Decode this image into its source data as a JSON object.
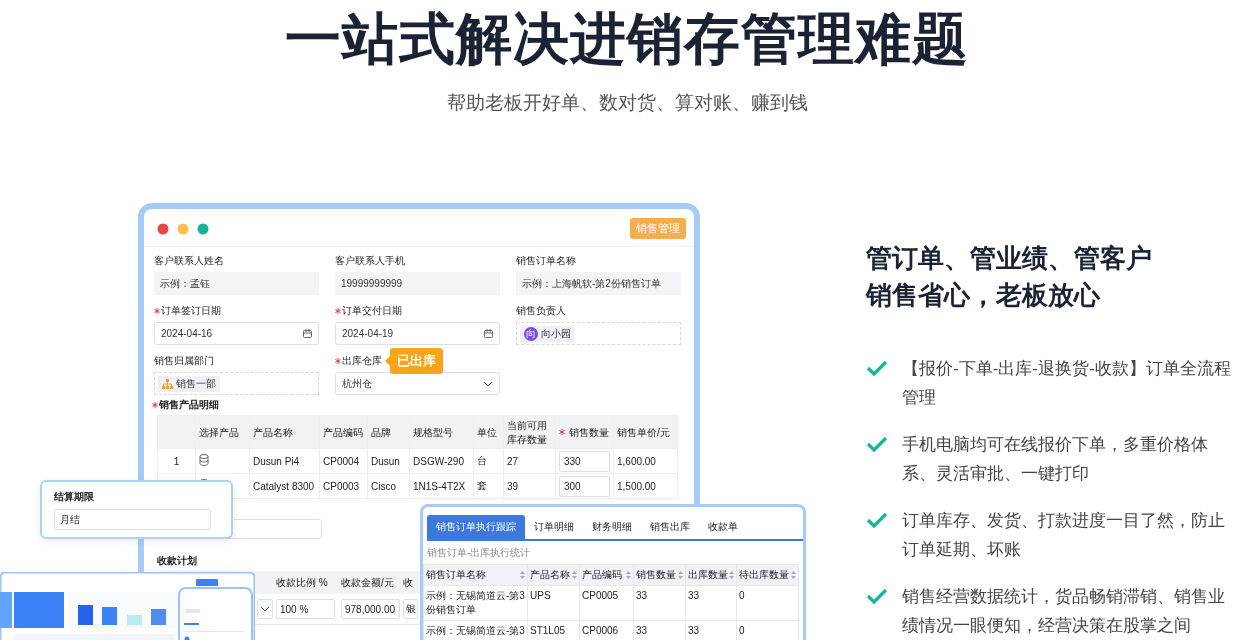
{
  "hero": {
    "title": "一站式解决进销存管理难题",
    "subtitle": "帮助老板开好单、数对货、算对账、赚到钱"
  },
  "window": {
    "badge": "销售管理",
    "fields": [
      {
        "kind": "text",
        "label": "客户联系人姓名",
        "required": false,
        "value": "示例：孟钰"
      },
      {
        "kind": "text",
        "label": "客户联系人手机",
        "required": false,
        "value": "19999999999"
      },
      {
        "kind": "text",
        "label": "销售订单名称",
        "required": false,
        "value": "示例：上海帆软-第2份销售订单"
      },
      {
        "kind": "date",
        "label": "订单签订日期",
        "required": true,
        "value": "2024-04-16"
      },
      {
        "kind": "date",
        "label": "订单交付日期",
        "required": true,
        "value": "2024-04-19"
      },
      {
        "kind": "person",
        "label": "销售负责人",
        "required": false,
        "avatar": "向",
        "value": "向小园"
      },
      {
        "kind": "dept",
        "label": "销售归属部门",
        "required": false,
        "value": "销售一部"
      },
      {
        "kind": "select",
        "label": "出库仓库",
        "required": true,
        "value": "杭州仓",
        "tooltip": "已出库"
      }
    ],
    "products": {
      "title": "销售产品明细",
      "required": true,
      "columns": [
        {
          "label": "选择产品",
          "required": false
        },
        {
          "label": "产品名称",
          "required": false
        },
        {
          "label": "产品编码",
          "required": false
        },
        {
          "label": "品牌",
          "required": false
        },
        {
          "label": "规格型号",
          "required": false
        },
        {
          "label": "单位",
          "required": false
        },
        {
          "label": "当前可用库存数量",
          "required": false
        },
        {
          "label": "销售数量",
          "required": true
        },
        {
          "label": "销售单价/元",
          "required": false
        }
      ],
      "rows": [
        {
          "index": "1",
          "name": "Dusun Pi4",
          "code": "CP0004",
          "brand": "Dusun",
          "spec": "DSGW-290",
          "unit": "台",
          "stock": "27",
          "quantity": "330",
          "price": "1,600.00"
        },
        {
          "name": "Catalyst 8300",
          "code": "CP0003",
          "brand": "Cisco",
          "spec": "1N1S-4T2X",
          "unit": "套",
          "stock": "39",
          "quantity": "300",
          "price": "1,500.00"
        }
      ]
    },
    "payment_plan": {
      "title": "收款计划",
      "columns": [
        "收款比例 %",
        "收款金额/元",
        "收"
      ],
      "ratio": "100 %",
      "amount": "978,000.00",
      "method": "银"
    }
  },
  "settlement_popup": {
    "label": "结算期限",
    "value": "月结"
  },
  "tracking": {
    "tabs": [
      {
        "label": "销售订单执行跟踪",
        "selected": true
      },
      {
        "label": "订单明细",
        "selected": false
      },
      {
        "label": "财务明细",
        "selected": false
      },
      {
        "label": "销售出库",
        "selected": false
      },
      {
        "label": "收款单",
        "selected": false
      }
    ],
    "caption": "销售订单-出库执行统计",
    "columns": [
      "销售订单名称",
      "产品名称",
      "产品编码",
      "销售数量",
      "出库数量",
      "待出库数量"
    ],
    "rows": [
      [
        "示例：无锡简道云-第3份销售订单",
        "UPS",
        "CP0005",
        "33",
        "33",
        "0"
      ],
      [
        "示例：无锡简道云-第3",
        "ST1L05",
        "CP0006",
        "33",
        "33",
        "0"
      ]
    ]
  },
  "features": {
    "title_lines": [
      "管订单、管业绩、管客户",
      "销售省心，老板放心"
    ],
    "items": [
      "【报价-下单-出库-退换货-收款】订单全流程管理",
      "手机电脑均可在线报价下单，多重价格体系、灵活审批、一键打印",
      "订单库存、发货、打款进度一目了然，防止订单延期、坏账",
      "销售经营数据统计，货品畅销滞销、销售业绩情况一眼便知，经营决策在股掌之间"
    ]
  }
}
